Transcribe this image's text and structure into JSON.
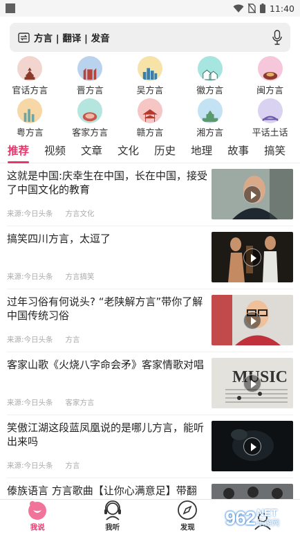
{
  "status_bar": {
    "time": "11:40"
  },
  "search": {
    "placeholder": "方言 | 翻译 | 发音"
  },
  "dialects": [
    {
      "label": "官话方言",
      "bg": "#f3d5cf",
      "icon": "temple-of-heaven-icon"
    },
    {
      "label": "晋方言",
      "bg": "#b9d3ef",
      "icon": "building-icon"
    },
    {
      "label": "吴方言",
      "bg": "#f7e3a8",
      "icon": "city-icon"
    },
    {
      "label": "徽方言",
      "bg": "#a7e6e0",
      "icon": "village-icon"
    },
    {
      "label": "闽方言",
      "bg": "#f6c7da",
      "icon": "tulou-icon"
    },
    {
      "label": "粤方言",
      "bg": "#f8d7a6",
      "icon": "skyline-icon"
    },
    {
      "label": "客家方言",
      "bg": "#b4e6df",
      "icon": "hakka-dish-icon"
    },
    {
      "label": "赣方言",
      "bg": "#f5c6c4",
      "icon": "pavilion-icon"
    },
    {
      "label": "湘方言",
      "bg": "#c3e3f4",
      "icon": "tower-icon"
    },
    {
      "label": "平话土话",
      "bg": "#d9d3f1",
      "icon": "bridge-icon"
    }
  ],
  "tabs": [
    "推荐",
    "视频",
    "文章",
    "文化",
    "历史",
    "地理",
    "故事",
    "搞笑"
  ],
  "active_tab": "推荐",
  "feed": [
    {
      "title": "这就是中国:庆幸生在中国，长在中国，接受了中国文化的教育",
      "source": "来源:今日头条",
      "category": "方言文化",
      "thumb": "thumb-man-speaking"
    },
    {
      "title": "搞笑四川方言，太逗了",
      "source": "来源:今日头条",
      "category": "方言搞笑",
      "thumb": "thumb-two-men"
    },
    {
      "title": "过年习俗有何说头? “老陕解方言”带你了解中国传统习俗",
      "source": "来源:今日头条",
      "category": "方言",
      "thumb": "thumb-man-glasses"
    },
    {
      "title": "客家山歌《火烧八字命会矛》客家情歌对唱",
      "source": "来源:今日头条",
      "category": "客家方言",
      "thumb": "thumb-music"
    },
    {
      "title": "笑傲江湖这段蓝凤凰说的是哪儿方言，能听出来吗",
      "source": "来源:今日头条",
      "category": "方言",
      "thumb": "thumb-dark-scene"
    },
    {
      "title": "傣族语言 方言歌曲【让你心满意足】带翻",
      "source": "",
      "category": "",
      "thumb": "thumb-people"
    }
  ],
  "bottom_nav": [
    {
      "label": "我说",
      "icon": "mouth-icon",
      "active": true
    },
    {
      "label": "我听",
      "icon": "headphones-icon",
      "active": false
    },
    {
      "label": "发现",
      "icon": "compass-icon",
      "active": false
    },
    {
      "label": "",
      "icon": "profile-icon",
      "active": false
    }
  ],
  "watermark": {
    "number": "962",
    "net": "NET",
    "caption": "乐游网"
  },
  "colors": {
    "accent": "#e8356b"
  }
}
